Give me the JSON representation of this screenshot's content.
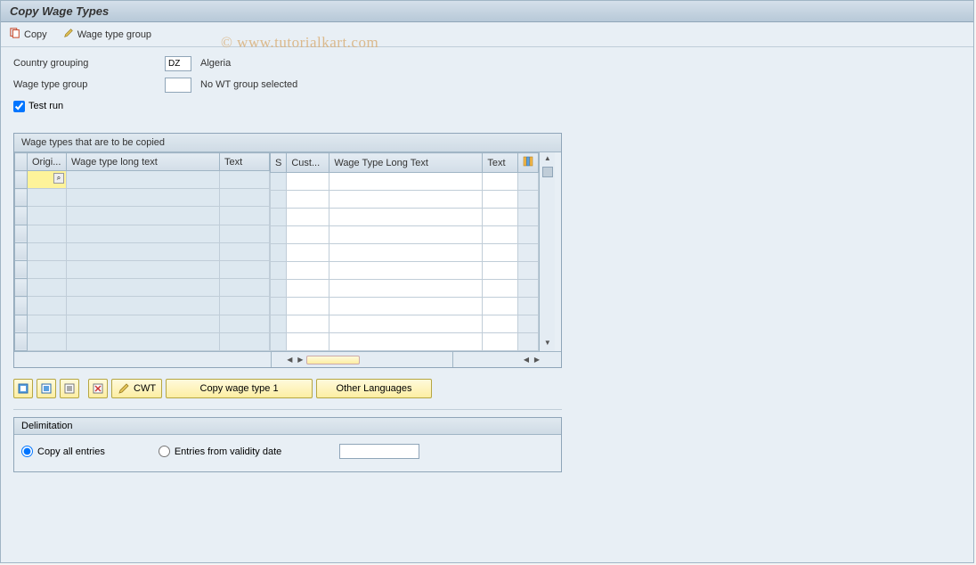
{
  "title": "Copy Wage Types",
  "toolbar": {
    "copy": "Copy",
    "wage_type_group": "Wage type group"
  },
  "form": {
    "country_grouping_label": "Country grouping",
    "country_grouping_value": "DZ",
    "country_grouping_text": "Algeria",
    "wage_type_group_label": "Wage type group",
    "wage_type_group_value": "",
    "wage_type_group_text": "No WT group selected",
    "test_run_label": "Test run",
    "test_run_checked": true
  },
  "table": {
    "group_title": "Wage types that are to be copied",
    "left_headers": [
      "Origi...",
      "Wage type long text",
      "Text"
    ],
    "right_headers": [
      "S",
      "Cust...",
      "Wage Type Long Text",
      "Text"
    ],
    "row_count": 10
  },
  "buttons": {
    "cwt": "CWT",
    "copy_wage_type_1": "Copy wage type 1",
    "other_languages": "Other Languages"
  },
  "delimitation": {
    "header": "Delimitation",
    "copy_all": "Copy all entries",
    "entries_from": "Entries from validity date",
    "selected": "copy_all",
    "date_value": ""
  },
  "watermark": "© www.tutorialkart.com"
}
